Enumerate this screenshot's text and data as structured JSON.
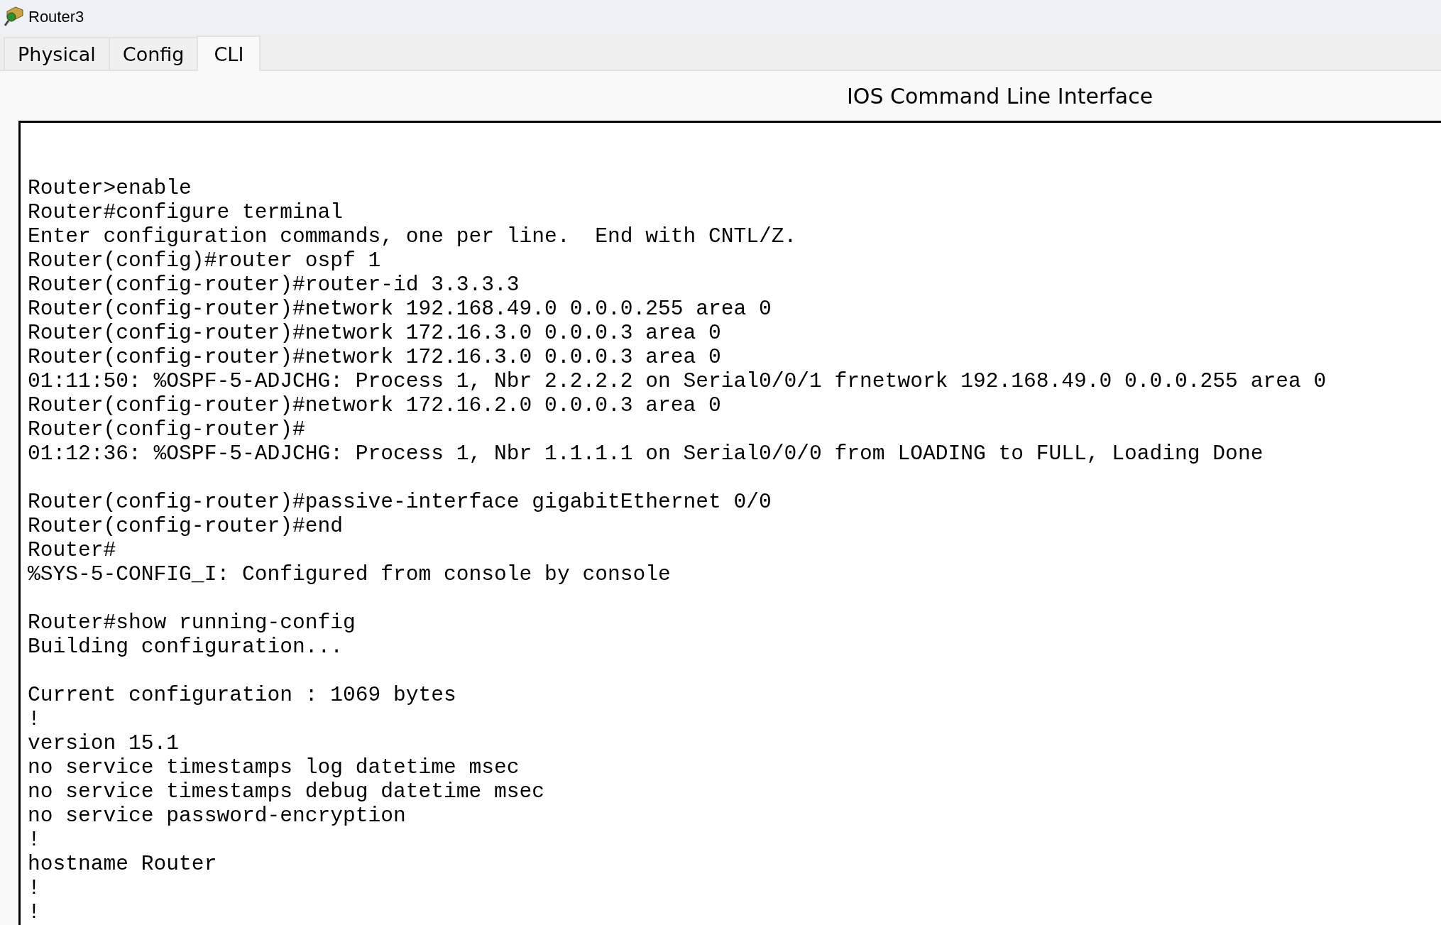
{
  "window": {
    "title": "Router3"
  },
  "tabs": [
    {
      "label": "Physical",
      "selected": false
    },
    {
      "label": "Config",
      "selected": false
    },
    {
      "label": "CLI",
      "selected": true
    }
  ],
  "panel_title": "IOS Command Line Interface",
  "terminal": {
    "blocks": [
      [
        "Router>enable",
        "Router#configure terminal",
        "Enter configuration commands, one per line.  End with CNTL/Z.",
        "Router(config)#router ospf 1",
        "Router(config-router)#router-id 3.3.3.3",
        "Router(config-router)#network 192.168.49.0 0.0.0.255 area 0",
        "Router(config-router)#network 172.16.3.0 0.0.0.3 area 0",
        "Router(config-router)#network 172.16.3.0 0.0.0.3 area 0",
        "01:11:50: %OSPF-5-ADJCHG: Process 1, Nbr 2.2.2.2 on Serial0/0/1 frnetwork 192.168.49.0 0.0.0.255 area 0",
        "Router(config-router)#network 172.16.2.0 0.0.0.3 area 0",
        "Router(config-router)#",
        "01:12:36: %OSPF-5-ADJCHG: Process 1, Nbr 1.1.1.1 on Serial0/0/0 from LOADING to FULL, Loading Done"
      ],
      [
        "Router(config-router)#passive-interface gigabitEthernet 0/0",
        "Router(config-router)#end",
        "Router#",
        "%SYS-5-CONFIG_I: Configured from console by console"
      ],
      [
        "Router#show running-config",
        "Building configuration..."
      ],
      [
        "Current configuration : 1069 bytes",
        "!",
        "version 15.1",
        "no service timestamps log datetime msec",
        "no service timestamps debug datetime msec",
        "no service password-encryption",
        "!",
        "hostname Router",
        "!",
        "!"
      ]
    ]
  }
}
